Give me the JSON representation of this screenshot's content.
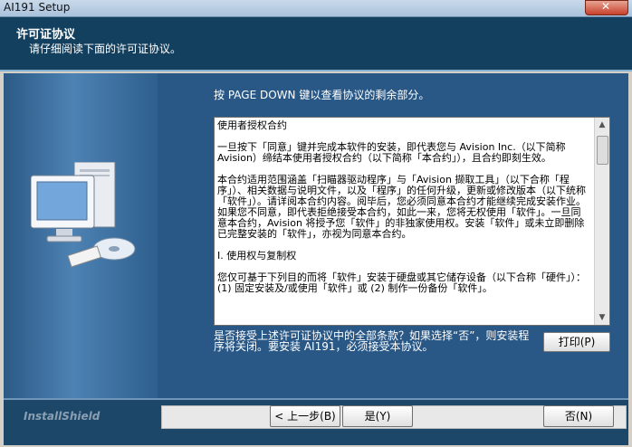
{
  "window": {
    "title": "AI191 Setup"
  },
  "header": {
    "title": "许可证协议",
    "subtitle": "请仔细阅读下面的许可证协议。"
  },
  "main": {
    "instruction": "按 PAGE DOWN 键以查看协议的剩余部分。",
    "license_text": "使用者授权合约\n\n一旦按下「同意」键并完成本软件的安装，即代表您与 Avision Inc.（以下简称 Avision）缔结本使用者授权合约（以下简称「本合约」），且合约即刻生效。\n\n本合约适用范围涵盖「扫瞄器驱动程序」与「Avision 撷取工具」（以下合称「程序」）、相关数据与说明文件，以及「程序」的任何升级，更新或修改版本（以下统称「软件」）。请详阅本合约内容。阅毕后，您必须同意本合约才能继续完成安装作业。如果您不同意，即代表拒绝接受本合约，如此一来，您将无权使用「软件」。一旦同意本合约，Avision 将授予您「软件」的非独家使用权。安装「软件」或未立即删除已完整安装的「软件」，亦视为同意本合约。\n\nI. 使用权与复制权\n\n您仅可基于下列目的而将「软件」安装于硬盘或其它储存设备（以下合称「硬件」）：(1) 固定安装及/或使用「软件」或 (2) 制作一份备份「软件」。",
    "question": "是否接受上述许可证协议中的全部条款？如果选择“否”，则安装程序将关闭。要安装 AI191，必须接受本协议。",
    "print_label": "打印(P)"
  },
  "footer": {
    "brand": "InstallShield",
    "back_label": "< 上一步(B)",
    "yes_label": "是(Y)",
    "no_label": "否(N)"
  }
}
